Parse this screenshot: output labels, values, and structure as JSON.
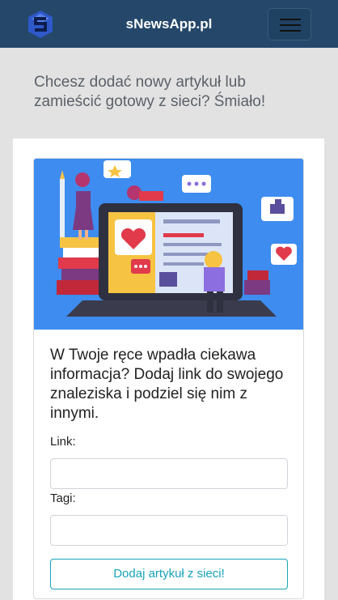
{
  "navbar": {
    "brand": "sNewsApp.pl",
    "logo_icon": "s-logo-icon",
    "menu_icon": "hamburger-icon"
  },
  "lead": "Chcesz dodać nowy artykuł lub zamieścić gotowy z sieci? Śmiało!",
  "card": {
    "text": "W Twoje ręce wpadła ciekawa informacja? Dodaj link do swojego znaleziska i podziel się nim z innymi.",
    "link_label": "Link:",
    "link_value": "",
    "tags_label": "Tagi:",
    "tags_value": "",
    "submit_label": "Dodaj artykuł z sieci!"
  },
  "colors": {
    "navbar": "#24476a",
    "background": "#e2e2e2",
    "accent": "#17a2b8",
    "illustration_bg": "#3e8cef"
  }
}
